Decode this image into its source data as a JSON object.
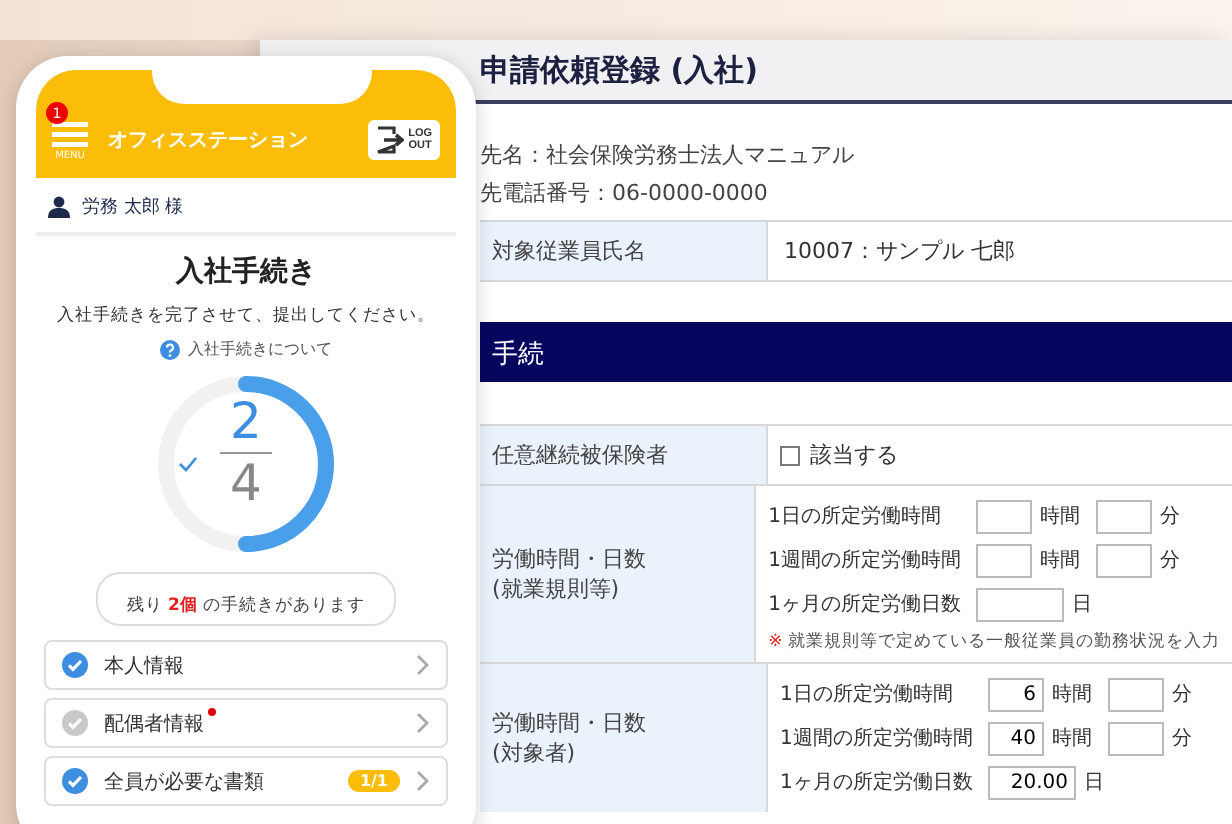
{
  "desktop": {
    "title": "申請依頼登録 (入社)",
    "info": [
      "先名：社会保険労務士法人マニュアル",
      "先電話番号：06-0000-0000"
    ],
    "employee": {
      "label": "対象従業員氏名",
      "value": "10007：サンプル 七郎"
    },
    "section": "手続",
    "rows": [
      {
        "kind": "checkbox",
        "label": [
          "任意継続被保険者"
        ],
        "checked": false,
        "text": "該当する"
      },
      {
        "kind": "hours",
        "label": [
          "労働時間・日数",
          "(就業規則等)"
        ],
        "lines": [
          {
            "label": "1日の所定労働時間",
            "parts": [
              {
                "kind": "input"
              },
              {
                "kind": "unit",
                "text": "時間"
              },
              {
                "kind": "input"
              },
              {
                "kind": "unit",
                "text": "分"
              }
            ]
          },
          {
            "label": "1週間の所定労働時間",
            "parts": [
              {
                "kind": "input"
              },
              {
                "kind": "unit",
                "text": "時間"
              },
              {
                "kind": "input"
              },
              {
                "kind": "unit",
                "text": "分"
              }
            ]
          },
          {
            "label": "1ヶ月の所定労働日数",
            "parts": [
              {
                "kind": "wide"
              },
              {
                "kind": "unit",
                "text": "日"
              }
            ]
          }
        ],
        "note": {
          "mark": "※",
          "text": "就業規則等で定めている一般従業員の勤務状況を入力"
        }
      },
      {
        "kind": "hours",
        "label": [
          "労働時間・日数",
          "(対象者)"
        ],
        "lines": [
          {
            "label": "1日の所定労働時間",
            "parts": [
              {
                "kind": "input",
                "value": "6"
              },
              {
                "kind": "unit",
                "text": "時間"
              },
              {
                "kind": "input"
              },
              {
                "kind": "unit",
                "text": "分"
              }
            ]
          },
          {
            "label": "1週間の所定労働時間",
            "parts": [
              {
                "kind": "input",
                "value": "40"
              },
              {
                "kind": "unit",
                "text": "時間"
              },
              {
                "kind": "input"
              },
              {
                "kind": "unit",
                "text": "分"
              }
            ]
          },
          {
            "label": "1ヶ月の所定労働日数",
            "parts": [
              {
                "kind": "wide",
                "value": "20.00"
              },
              {
                "kind": "unit",
                "text": "日"
              }
            ]
          }
        ]
      }
    ]
  },
  "phone": {
    "badge": "1",
    "menu_label": "MENU",
    "app_name": "オフィスステーション",
    "logout": [
      "LOG",
      "OUT"
    ],
    "user": "労務 太郎 様",
    "title": "入社手続き",
    "subtitle": "入社手続きを完了させて、提出してください。",
    "help_link": "入社手続きについて",
    "progress": {
      "done": "2",
      "total": "4",
      "level": 0.5
    },
    "remaining": {
      "prefix": "残り",
      "count": "2個",
      "suffix": "の手続きがあります"
    },
    "items": [
      {
        "label": "本人情報",
        "done": true,
        "notice": false
      },
      {
        "label": "配偶者情報",
        "done": false,
        "notice": true
      },
      {
        "label": "全員が必要な書類",
        "done": true,
        "notice": false,
        "badge": "1/1"
      }
    ]
  }
}
